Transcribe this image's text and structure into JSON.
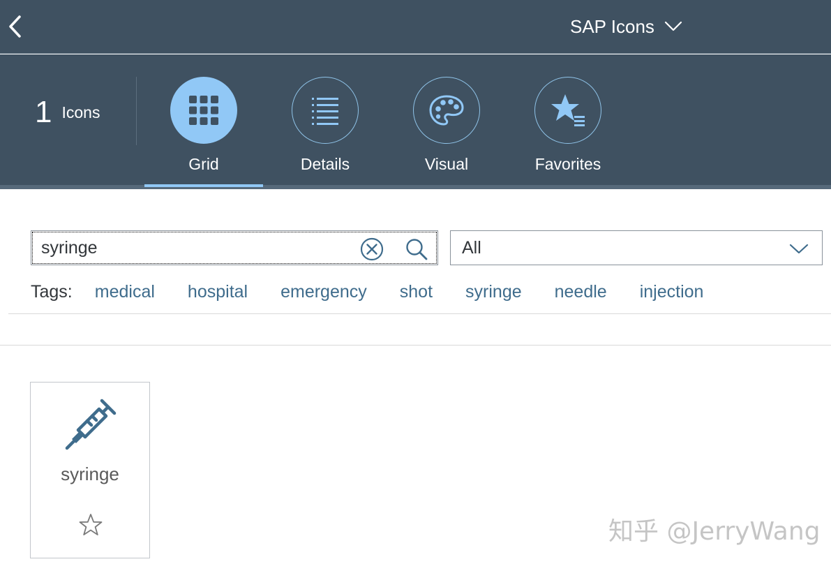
{
  "shell": {
    "title": "SAP Icons"
  },
  "header": {
    "count": "1",
    "count_label": "Icons"
  },
  "tabs": [
    {
      "label": "Grid",
      "icon": "grid-icon",
      "selected": true
    },
    {
      "label": "Details",
      "icon": "list-icon",
      "selected": false
    },
    {
      "label": "Visual",
      "icon": "palette-icon",
      "selected": false
    },
    {
      "label": "Favorites",
      "icon": "favorite-list-icon",
      "selected": false
    }
  ],
  "search": {
    "value": "syringe"
  },
  "category": {
    "selected": "All"
  },
  "tags": {
    "label": "Tags:",
    "items": [
      "medical",
      "hospital",
      "emergency",
      "shot",
      "syringe",
      "needle",
      "injection"
    ]
  },
  "results": [
    {
      "name": "syringe",
      "icon": "syringe-icon",
      "favorite": false
    }
  ],
  "watermark": "知乎 @JerryWang",
  "colors": {
    "shell_bg": "#3f5161",
    "accent": "#91c8f6",
    "link": "#3f6c8c",
    "icon": "#3f6c8c"
  }
}
